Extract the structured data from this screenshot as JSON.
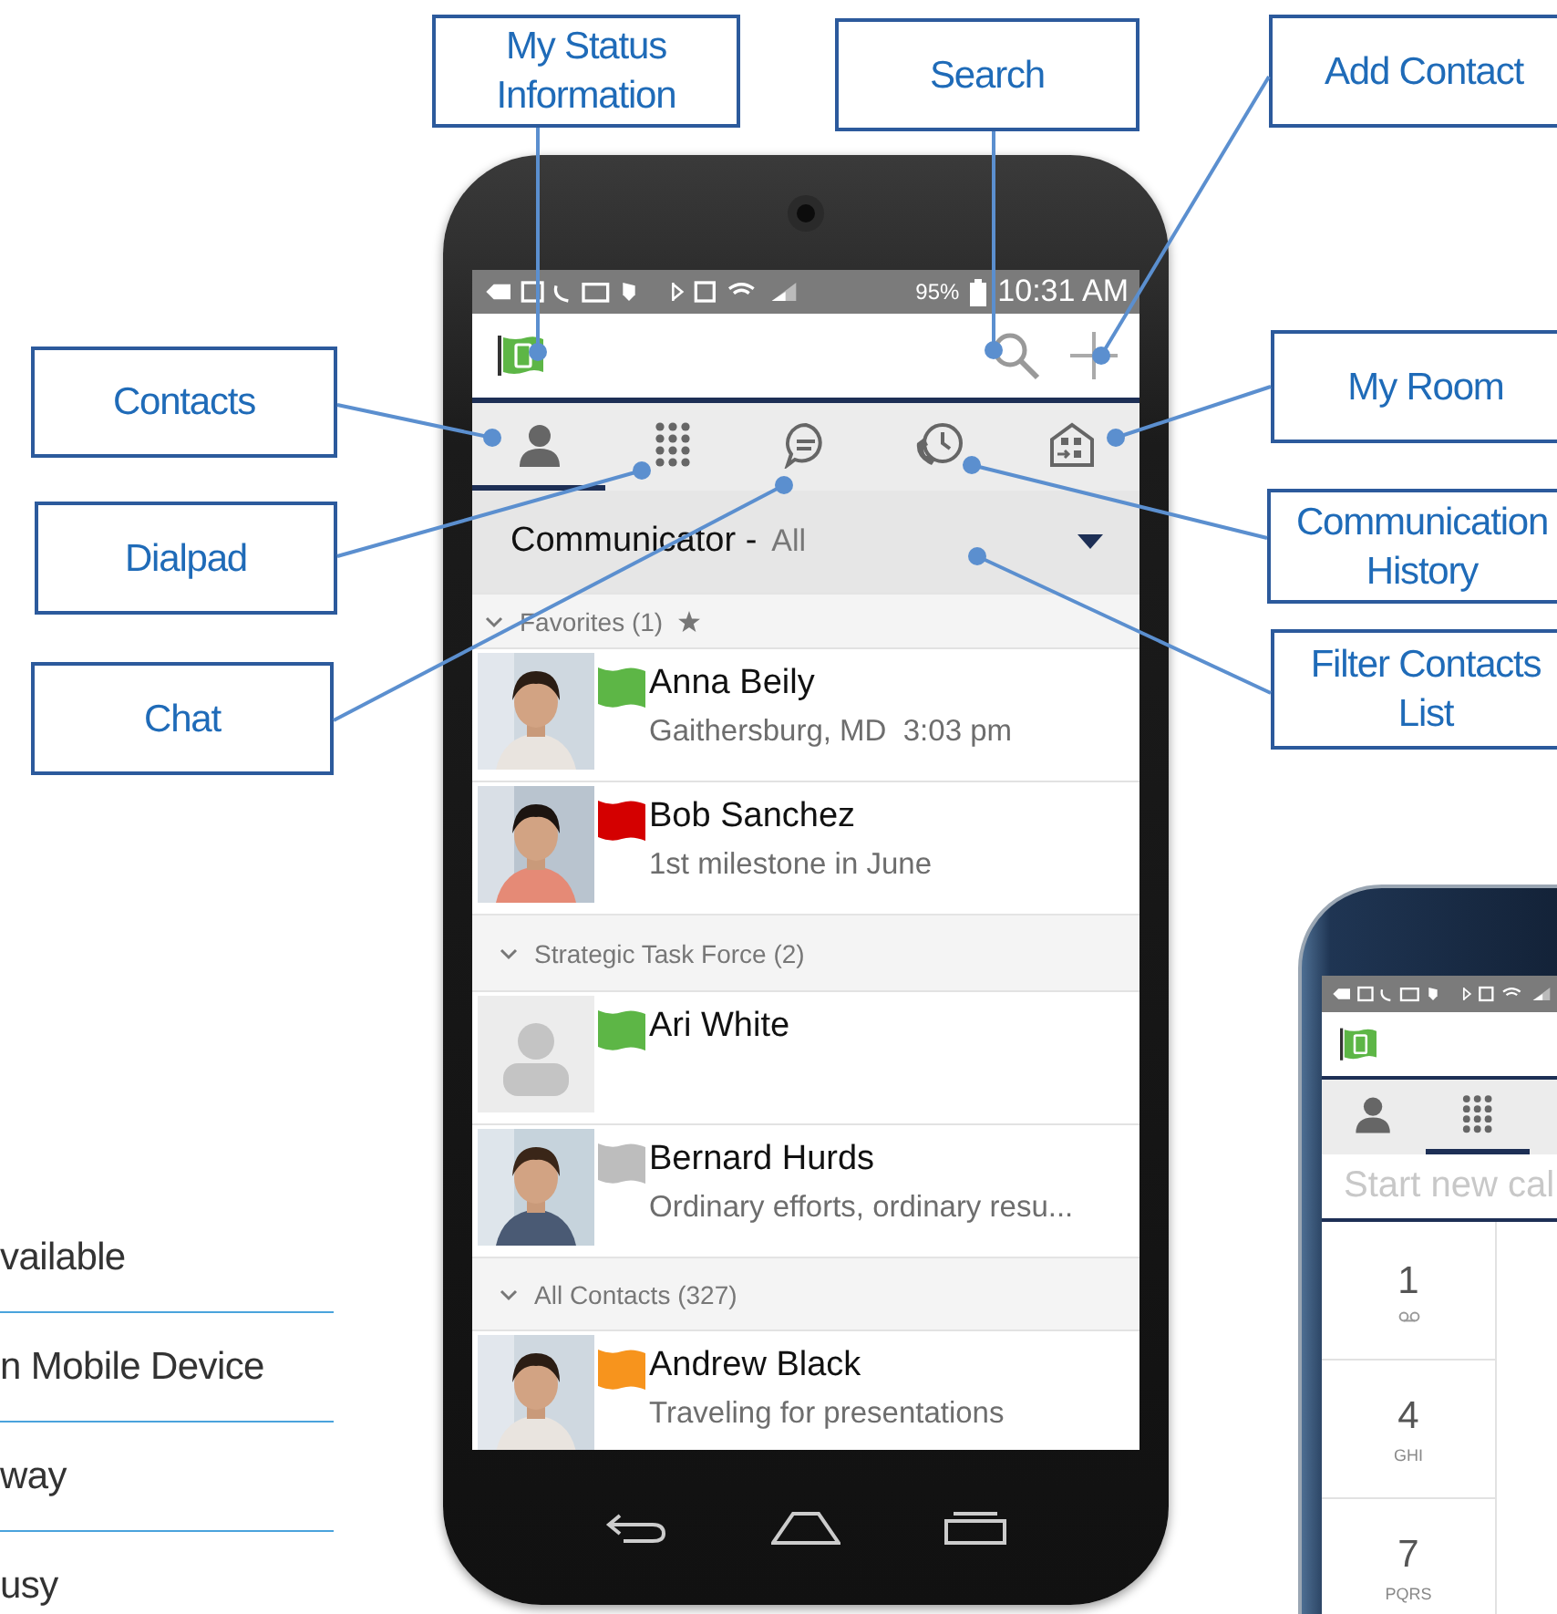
{
  "callouts": [
    {
      "text": "My Status Information"
    },
    {
      "text": "Search"
    },
    {
      "text": "Add Contact"
    },
    {
      "text": "Contacts"
    },
    {
      "text": "My Room"
    },
    {
      "text": "Dialpad"
    },
    {
      "text": "Communication History"
    },
    {
      "text": "Chat"
    },
    {
      "text": "Filter Contacts List"
    }
  ],
  "legend": [
    "vailable",
    "n Mobile Device",
    "way",
    "usy"
  ],
  "main_phone": {
    "status_bar": {
      "battery": "95%",
      "time": "10:31 AM"
    },
    "tabs": [
      {
        "kind": "contacts",
        "selected": true
      },
      {
        "kind": "dialpad",
        "selected": false
      },
      {
        "kind": "chat",
        "selected": false
      },
      {
        "kind": "history",
        "selected": false
      },
      {
        "kind": "room",
        "selected": false
      }
    ],
    "filter": {
      "label": "Communicator -",
      "value": "All"
    },
    "groups": [
      {
        "title": "Favorites (1)",
        "expanded": true,
        "favorite": true,
        "contacts": [
          {
            "name": "Anna Beily",
            "detail": "Gaithersburg, MD  3:03 pm",
            "color": "#5db646",
            "kind": "picture"
          },
          {
            "name": "Bob Sanchez",
            "detail": "1st milestone in June",
            "color": "#d40000",
            "kind": "picture"
          }
        ]
      },
      {
        "title": "Strategic Task Force (2)",
        "expanded": true,
        "favorite": false,
        "contacts": [
          {
            "name": "Ari White",
            "color": "#5db646",
            "kind": "placeholder"
          },
          {
            "name": "Bernard Hurds",
            "detail": "Ordinary efforts, ordinary resu...",
            "color": "#bdbdbd",
            "kind": "picture"
          }
        ]
      },
      {
        "title": "All Contacts (327)",
        "expanded": true,
        "favorite": false,
        "contacts": [
          {
            "name": "Andrew Black",
            "detail": "Traveling for presentations",
            "color": "#f7941d",
            "kind": "picture"
          }
        ]
      }
    ]
  },
  "second_phone": {
    "tabs": [
      {
        "kind": "contacts",
        "selected": false
      },
      {
        "kind": "dialpad",
        "selected": true
      }
    ],
    "dial_field": {
      "placeholder": "Start new cal"
    },
    "keys": [
      {
        "digit": "1",
        "kind": "voicemail"
      },
      {
        "digit": "4",
        "letters": "GHI",
        "kind": "letters"
      },
      {
        "digit": "7",
        "letters": "PQRS",
        "kind": "letters"
      }
    ]
  }
}
